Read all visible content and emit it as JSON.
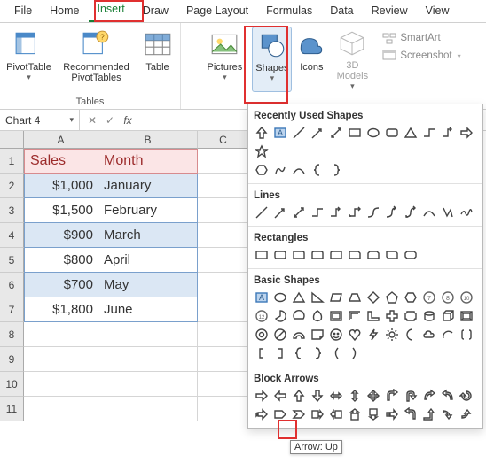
{
  "tabs": [
    "File",
    "Home",
    "Insert",
    "Draw",
    "Page Layout",
    "Formulas",
    "Data",
    "Review",
    "View"
  ],
  "activeTab": "Insert",
  "ribbon": {
    "tables": {
      "pivot": "PivotTable",
      "rec": "Recommended\nPivotTables",
      "table": "Table",
      "group": "Tables"
    },
    "ill": {
      "pictures": "Pictures",
      "shapes": "Shapes",
      "icons": "Icons",
      "models": "3D\nModels",
      "smartart": "SmartArt",
      "screenshot": "Screenshot"
    }
  },
  "namebox": "Chart 4",
  "fx": "fx",
  "cols": [
    "A",
    "B",
    "C"
  ],
  "table": {
    "head": [
      "Sales",
      "Month"
    ],
    "rows": [
      [
        "$1,000",
        "January"
      ],
      [
        "$1,500",
        "February"
      ],
      [
        "$900",
        "March"
      ],
      [
        "$800",
        "April"
      ],
      [
        "$700",
        "May"
      ],
      [
        "$1,800",
        "June"
      ]
    ]
  },
  "rowNums": [
    "1",
    "2",
    "3",
    "4",
    "5",
    "6",
    "7",
    "8",
    "9",
    "10",
    "11"
  ],
  "shapesPanel": {
    "recent": "Recently Used Shapes",
    "lines": "Lines",
    "rects": "Rectangles",
    "basic": "Basic Shapes",
    "arrows": "Block Arrows"
  },
  "tooltip": "Arrow: Up",
  "chart_data": {
    "type": "table",
    "title": "",
    "columns": [
      "Sales",
      "Month"
    ],
    "rows": [
      [
        1000,
        "January"
      ],
      [
        1500,
        "February"
      ],
      [
        900,
        "March"
      ],
      [
        800,
        "April"
      ],
      [
        700,
        "May"
      ],
      [
        1800,
        "June"
      ]
    ]
  }
}
